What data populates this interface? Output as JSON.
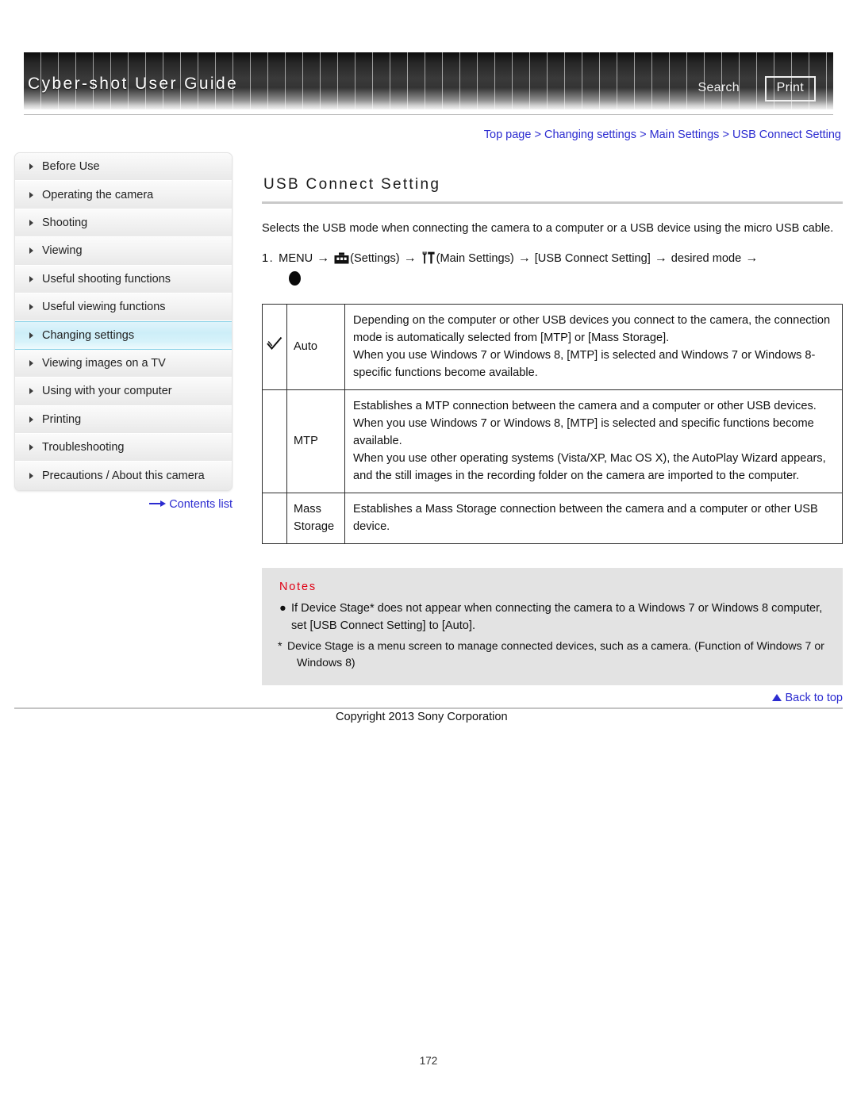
{
  "header": {
    "title": "Cyber-shot User Guide",
    "search_label": "Search",
    "print_label": "Print"
  },
  "breadcrumb": {
    "items": [
      "Top page",
      "Changing settings",
      "Main Settings",
      "USB Connect Setting"
    ],
    "separator": " > ",
    "link_color": "#2b2bd0"
  },
  "sidebar": {
    "items": [
      {
        "label": "Before Use",
        "active": false
      },
      {
        "label": "Operating the camera",
        "active": false
      },
      {
        "label": "Shooting",
        "active": false
      },
      {
        "label": "Viewing",
        "active": false
      },
      {
        "label": "Useful shooting functions",
        "active": false
      },
      {
        "label": "Useful viewing functions",
        "active": false
      },
      {
        "label": "Changing settings",
        "active": true
      },
      {
        "label": "Viewing images on a TV",
        "active": false
      },
      {
        "label": "Using with your computer",
        "active": false
      },
      {
        "label": "Printing",
        "active": false
      },
      {
        "label": "Troubleshooting",
        "active": false
      },
      {
        "label": "Precautions / About this camera",
        "active": false
      }
    ],
    "contents_list_label": "Contents list",
    "active_highlight_color": "#cdeef8"
  },
  "main": {
    "page_title": "USB Connect Setting",
    "intro": "Selects the USB mode when connecting the camera to a computer or a USB device using the micro USB cable.",
    "step": {
      "number": "1.",
      "part1": "MENU",
      "icon1_label": "(Settings)",
      "icon1_name": "toolbox-icon",
      "icon2_label": "(Main Settings)",
      "icon2_name": "tools-icon",
      "part2": "[USB Connect Setting]",
      "part3": "desired mode",
      "arrow": "→",
      "end_icon_name": "center-button-icon"
    },
    "table": {
      "rows": [
        {
          "checked": true,
          "label": "Auto",
          "description": "Depending on the computer or other USB devices you connect to the camera, the connection mode is automatically selected from [MTP] or [Mass Storage].\nWhen you use Windows 7 or Windows 8, [MTP] is selected and Windows 7 or Windows 8-specific functions become available."
        },
        {
          "checked": false,
          "label": "MTP",
          "description": "Establishes a MTP connection between the camera and a computer or other USB devices.\nWhen you use Windows 7 or Windows 8, [MTP] is selected and specific functions become available.\nWhen you use other operating systems (Vista/XP, Mac OS X), the AutoPlay Wizard appears, and the still images in the recording folder on the camera are imported to the computer."
        },
        {
          "checked": false,
          "label": "Mass Storage",
          "description": "Establishes a Mass Storage connection between the camera and a computer or other USB device."
        }
      ]
    },
    "notes": {
      "heading": "Notes",
      "heading_color": "#e00014",
      "bullets": [
        "If Device Stage* does not appear when connecting the camera to a Windows 7 or Windows 8 computer, set [USB Connect Setting] to [Auto]."
      ],
      "footnote_marker": "*",
      "footnote_line1": "Device Stage is a menu screen to manage connected devices, such as a camera. (Function of Windows 7 or",
      "footnote_line2": "Windows 8)"
    }
  },
  "footer": {
    "back_to_top_label": "Back to top",
    "copyright": "Copyright 2013 Sony Corporation",
    "page_number": "172"
  }
}
